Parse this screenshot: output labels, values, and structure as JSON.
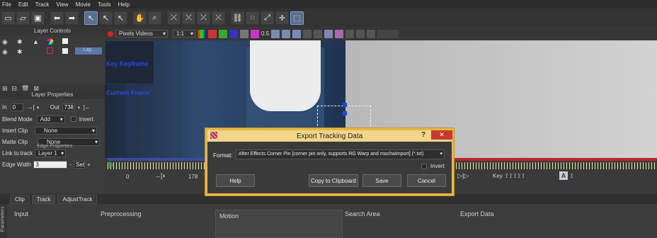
{
  "menu": [
    "File",
    "Edit",
    "Track",
    "View",
    "Movie",
    "Tools",
    "Help"
  ],
  "layer_controls": {
    "title": "Layer Controls",
    "layer1_name": "Lay..."
  },
  "layer_properties": {
    "title": "Layer Properties",
    "in_label": "In",
    "in_value": "0",
    "out_label": "Out",
    "out_value": "738",
    "blend_label": "Blend Mode",
    "blend_value": "Add",
    "invert_label": "Invert",
    "insert_clip_label": "Insert Clip",
    "insert_clip_value": "None",
    "matte_clip_label": "Matte Clip",
    "matte_clip_value": "None",
    "link_label": "Link to track",
    "link_value": "Layer 1",
    "edge_label": "Edge Width",
    "edge_value": "3",
    "edge_set": "Set",
    "edge_props": "Edge Properties"
  },
  "viewer": {
    "clip_select": "Pixels Videos",
    "zoom": "1:1",
    "opacity": "0.5",
    "overlay_key": "Key Keyframe",
    "overlay_current": "Current Frame"
  },
  "timeline": {
    "start": "0",
    "frame": "178",
    "key_label": "Key",
    "key_glyph": "A"
  },
  "bottom_tabs": [
    "Clip",
    "Track",
    "AdjustTrack"
  ],
  "params": {
    "side_label": "Parameters",
    "sections": [
      "Input",
      "Preprocessing",
      "Motion",
      "Search Area",
      "Export Data"
    ]
  },
  "dialog": {
    "title": "Export Tracking Data",
    "help_glyph": "?",
    "close_glyph": "✕",
    "format_label": "Format:",
    "format_value": "After Effects Corner Pin [corner pin only, supports RG Warp and mochaImport] (*.txt)",
    "invert_label": "Invert",
    "help_btn": "Help",
    "copy_btn": "Copy to Clipboard",
    "save_btn": "Save",
    "cancel_btn": "Cancel"
  },
  "colors": {
    "dialog_border": "#e4b847",
    "track_red": "#c0232a",
    "track_blue": "#3a4aa0",
    "keyframe_green": "#28a745"
  }
}
